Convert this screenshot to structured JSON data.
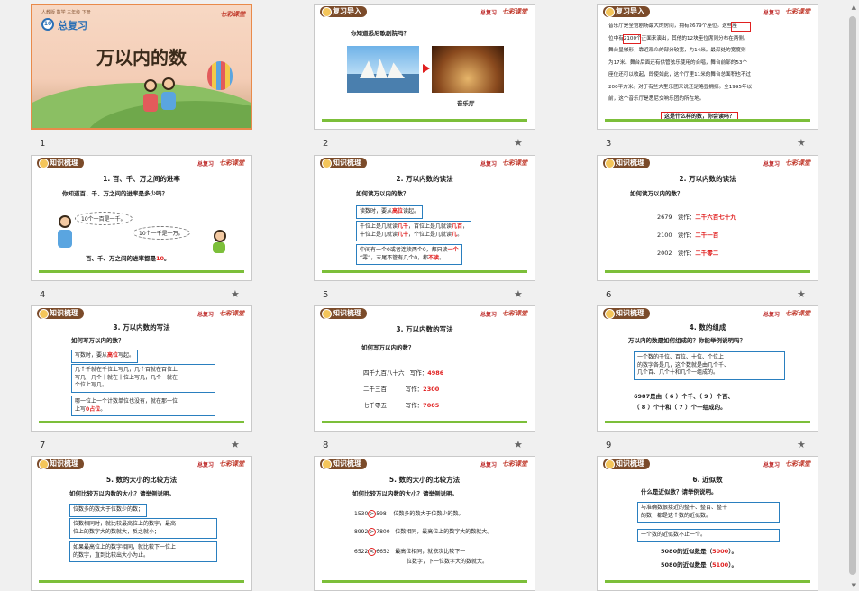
{
  "slides": [
    {
      "num": "1",
      "top_label": "人教版 数学 三年级 下册",
      "badge": "10",
      "label": "总复习",
      "title": "万以内的数",
      "logo": "七彩课堂"
    },
    {
      "num": "2",
      "tag": "复习导入",
      "sub": "总复习",
      "logo": "七彩课堂",
      "question": "你知道悉尼歌剧院吗？",
      "caption": "音乐厅"
    },
    {
      "num": "3",
      "tag": "复习导入",
      "sub": "总复习",
      "logo": "七彩课堂",
      "lines": [
        "音乐厅是全馆剧场最大的房间，拥有2679个座位。这些座",
        "位中有2100个正面来演出，其他的12块座位席则分布在两侧。",
        "舞台呈梯形，靠近观众的部分较宽，为14米。最深处的宽度则",
        "为17米。舞台后面还有供管弦乐使用的合唱，舞台前部的53个",
        "座位还可以收起，即使如此，这个厅里11米的舞台总面积也不过",
        "200平方米。对于有些大型乐团来说还是略显拥挤。全1995年以",
        "前，这个音乐厅是悉尼交响乐团的所在地。"
      ],
      "question": "这是什么样的数，你会读吗？"
    },
    {
      "num": "4",
      "tag": "知识梳理",
      "sub": "总复习",
      "logo": "七彩课堂",
      "title": "1. 百、千、万之间的进率",
      "question": "你知道百、千、万之间的进率是多少吗？",
      "bubble1": "10个一百是一千。",
      "bubble2": "10个一千是一万。",
      "conclusion_pre": "百、千、万之间的进率都是",
      "conclusion_val": "10",
      "conclusion_post": "。"
    },
    {
      "num": "5",
      "tag": "知识梳理",
      "sub": "总复习",
      "logo": "七彩课堂",
      "title": "2. 万以内数的读法",
      "question": "如何读万以内的数？",
      "box1_pre": "读数时，要从",
      "box1_red": "高位",
      "box1_post": "读起。",
      "box2_l1_pre": "千位上是几就读",
      "box2_l1_red": "几千",
      "box2_l1_mid": "，百位上是几就读",
      "box2_l1_red2": "几百",
      "box2_l1_post": "，",
      "box2_l2_pre": "十位上是几就读",
      "box2_l2_red": "几十",
      "box2_l2_mid": "，个位上是几就读",
      "box2_l2_red2": "几",
      "box2_l2_post": "。",
      "box3_l1_pre": "中间有一个0或者连续两个0，都只读",
      "box3_l1_red": "一个",
      "box3_l2_pre": "“零”，末尾不管有几个0，都",
      "box3_l2_red": "不读",
      "box3_l2_post": "。"
    },
    {
      "num": "6",
      "tag": "知识梳理",
      "sub": "总复习",
      "logo": "七彩课堂",
      "title": "2. 万以内数的读法",
      "question": "如何读万以内的数？",
      "rows": [
        {
          "n": "2679",
          "l": "读作：",
          "v": "二千六百七十九"
        },
        {
          "n": "2100",
          "l": "读作：",
          "v": "二千一百"
        },
        {
          "n": "2002",
          "l": "读作：",
          "v": "二千零二"
        }
      ]
    },
    {
      "num": "7",
      "tag": "知识梳理",
      "sub": "总复习",
      "logo": "七彩课堂",
      "title": "3. 万以内数的写法",
      "question": "如何写万以内的数？",
      "box1_pre": "写数时，要从",
      "box1_red": "高位",
      "box1_post": "写起。",
      "box2_lines": [
        "几个千就在千位上写几，几个百就在百位上",
        "写几，几个十就在十位上写几，几个一就在",
        "个位上写几。"
      ],
      "box3_l1": "哪一位上一个计数单位也没有，就在那一位",
      "box3_l2_pre": "上写",
      "box3_l2_red": "0占位",
      "box3_l2_post": "。"
    },
    {
      "num": "8",
      "tag": "知识梳理",
      "sub": "总复习",
      "logo": "七彩课堂",
      "title": "3. 万以内数的写法",
      "question": "如何写万以内的数？",
      "rows": [
        {
          "n": "四千九百八十六",
          "l": "写作：",
          "v": "4986"
        },
        {
          "n": "二千三百",
          "l": "写作：",
          "v": "2300"
        },
        {
          "n": "七千零五",
          "l": "写作：",
          "v": "7005"
        }
      ]
    },
    {
      "num": "9",
      "tag": "知识梳理",
      "sub": "总复习",
      "logo": "七彩课堂",
      "title": "4. 数的组成",
      "question": "万以内的数是如何组成的？你能举例说明吗？",
      "box_lines": [
        "一个数的千位、百位、十位、个位上",
        "的数字各是几，这个数就是由几个千、",
        "几个百、几个十和几个一组成的。"
      ],
      "ex1": "6987是由（ 6 ）个千、（ 9 ）个百、",
      "ex2": "（ 8 ）个十和（ 7 ）个一组成的。"
    },
    {
      "num": "10",
      "tag": "知识梳理",
      "sub": "总复习",
      "logo": "七彩课堂",
      "title": "5. 数的大小的比较方法",
      "question": "如何比较万以内数的大小？请举例说明。",
      "box1": "位数多的数大于位数少的数；",
      "box2_lines": [
        "位数相同时，就比较最高位上的数字，最高",
        "位上的数字大的数就大，反之就小；"
      ],
      "box3_lines": [
        "如果最高位上的数字相同，就比较下一位上",
        "的数字，直到比较出大小为止。"
      ]
    },
    {
      "num": "11",
      "tag": "知识梳理",
      "sub": "总复习",
      "logo": "七彩课堂",
      "title": "5. 数的大小的比较方法",
      "question": "如何比较万以内数的大小？请举例说明。",
      "cmp": [
        {
          "a": "1530",
          "op": ">",
          "b": "598",
          "t": "位数多的数大于位数少的数。"
        },
        {
          "a": "8992",
          "op": ">",
          "b": "7800",
          "t": "位数相同，最高位上的数字大的数就大。"
        },
        {
          "a": "6522",
          "op": "<",
          "b": "6652",
          "t": "最高位相同，就依次比较下一",
          "t2": "位数字，下一位数字大的数就大。"
        }
      ]
    },
    {
      "num": "12",
      "tag": "知识梳理",
      "sub": "总复习",
      "logo": "七彩课堂",
      "title": "6. 近似数",
      "question": "什么是近似数？请举例说明。",
      "box1_lines": [
        "与准确数很接近的整十、整百、整千",
        "的数，都是这个数的近似数。"
      ],
      "box2": "一个数的近似数不止一个。",
      "ex1_pre": "5080的近似数是（",
      "ex1_val": "5000",
      "ex1_post": "）。",
      "ex2_pre": "5080的近似数是（",
      "ex2_val": "5100",
      "ex2_post": "）。"
    }
  ],
  "scrollbar": {
    "up": "▲",
    "down": "▼"
  },
  "star": "★"
}
